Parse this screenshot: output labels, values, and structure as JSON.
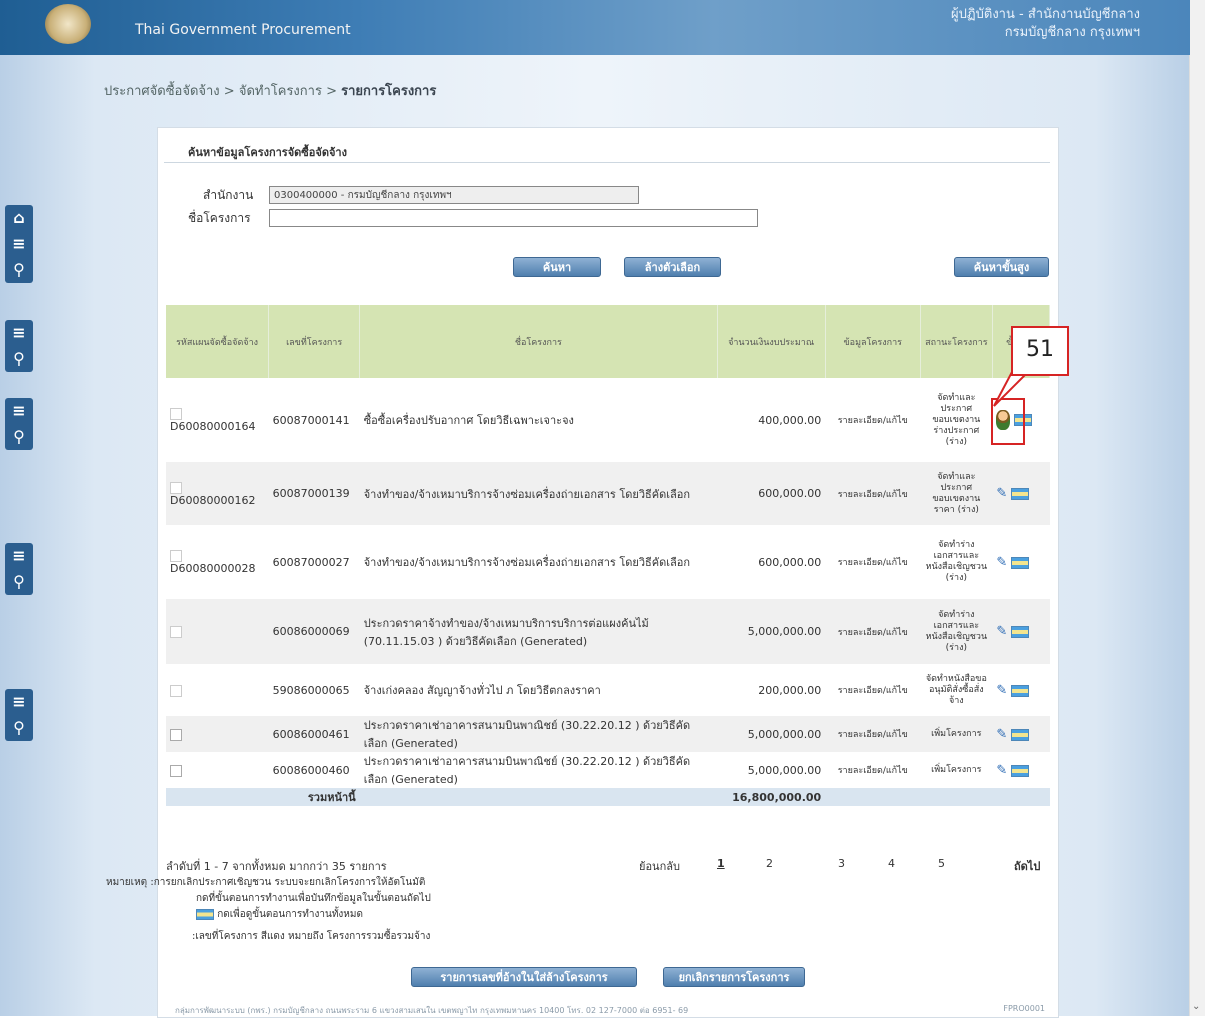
{
  "header": {
    "title": "Thai Government Procurement",
    "right_line1": "ผู้ปฏิบัติงาน - สำนักงานบัญชีกลาง",
    "right_line2": "กรมบัญชีกลาง กรุงเทพฯ"
  },
  "breadcrumb": {
    "part1": "ประกาศจัดซื้อจัดจ้าง",
    "sep": ">",
    "part2": "จัดทำโครงการ",
    "part3": "รายการโครงการ"
  },
  "sidebar": {
    "icons": [
      "home-icon",
      "menu-icon",
      "search-icon"
    ]
  },
  "search": {
    "panel_title": "ค้นหาข้อมูลโครงการจัดซื้อจัดจ้าง",
    "office_label": "สำนักงาน",
    "office_value": "0300400000 - กรมบัญชีกลาง กรุงเทพฯ",
    "project_label": "ชื่อโครงการ",
    "project_value": "",
    "search_button": "ค้นหา",
    "clear_button": "ล้างตัวเลือก",
    "advanced_button": "ค้นหาขั้นสูง"
  },
  "table": {
    "headers": {
      "plan_no": "รหัสแผนจัดซื้อจัดจ้าง",
      "project_no": "เลขที่โครงการ",
      "project_name": "ชื่อโครงการ",
      "budget": "จำนวนเงินงบประมาณ",
      "info": "ข้อมูลโครงการ",
      "status": "สถานะโครงการ",
      "step": "ขั้นตอน"
    },
    "link_text": "รายละเอียด/แก้ไข",
    "rows": [
      {
        "plan_no": "D60080000164",
        "project_no": "60087000141",
        "name": "ซื้อซื้อเครื่องปรับอากาศ โดยวิธีเฉพาะเจาะจง",
        "budget": "400,000.00",
        "status": "จัดทำและประกาศ ขอบเขตงาน ร่างประกาศ (ร่าง)"
      },
      {
        "plan_no": "D60080000162",
        "project_no": "60087000139",
        "name": "จ้างทำของ/จ้างเหมาบริการจ้างซ่อมเครื่องถ่ายเอกสาร โดยวิธีคัดเลือก",
        "budget": "600,000.00",
        "status": "จัดทำและประกาศ ขอบเขตงาน ราคา (ร่าง)"
      },
      {
        "plan_no": "D60080000028",
        "project_no": "60087000027",
        "name": "จ้างทำของ/จ้างเหมาบริการจ้างซ่อมเครื่องถ่ายเอกสาร โดยวิธีคัดเลือก",
        "budget": "600,000.00",
        "status": "จัดทำร่างเอกสารและหนังสือเชิญชวน (ร่าง)"
      },
      {
        "plan_no": "",
        "project_no": "60086000069",
        "name": "ประกวดราคาจ้างทำของ/จ้างเหมาบริการบริการต่อแผงค้นไม้ (70.11.15.03 ) ด้วยวิธีคัดเลือก (Generated)",
        "budget": "5,000,000.00",
        "status": "จัดทำร่างเอกสารและหนังสือเชิญชวน (ร่าง)"
      },
      {
        "plan_no": "",
        "project_no": "59086000065",
        "name": "จ้างเก่งคลอง สัญญาจ้างทั่วไป ภ โดยวิธีตกลงราคา",
        "budget": "200,000.00",
        "status": "จัดทำหนังสือขออนุมัติสั่งซื้อสั่งจ้าง"
      },
      {
        "plan_no": "",
        "project_no": "60086000461",
        "name": "ประกวดราคาเช่าอาคารสนามบินพาณิชย์ (30.22.20.12 ) ด้วยวิธีคัดเลือก (Generated)",
        "budget": "5,000,000.00",
        "status": "เพิ่มโครงการ"
      },
      {
        "plan_no": "",
        "project_no": "60086000460",
        "name": "ประกวดราคาเช่าอาคารสนามบินพาณิชย์ (30.22.20.12 ) ด้วยวิธีคัดเลือก (Generated)",
        "budget": "5,000,000.00",
        "status": "เพิ่มโครงการ"
      }
    ],
    "total_label": "รวมหน้านี้",
    "total_value": "16,800,000.00"
  },
  "pagination": {
    "summary": "ลำดับที่ 1 - 7 จากทั้งหมด มากกว่า 35 รายการ",
    "prev": "ย้อนกลับ",
    "pages": [
      "1",
      "2",
      "3",
      "4",
      "5"
    ],
    "next": "ถัดไป"
  },
  "notes": {
    "line1": "หมายเหตุ :การยกเลิกประกาศเชิญชวน ระบบจะยกเลิกโครงการให้อัตโนมัติ",
    "line2": "กดที่ขั้นตอนการทำงานเพื่อบันทึกข้อมูลในขั้นตอนถัดไป",
    "line3": "กดเพื่อดูขั้นตอนการทำงานทั้งหมด",
    "line4": ":เลขที่โครงการ สีแดง หมายถึง โครงการรวมซื้อรวมจ้าง"
  },
  "bottom_buttons": {
    "left": "รายการเลขที่อ้างในใส่ล้างโครงการ",
    "right": "ยกเลิกรายการโครงการ"
  },
  "footer": {
    "text": "กลุ่มการพัฒนาระบบ (กพร.) กรมบัญชีกลาง ถนนพระราม 6 แขวงสามเสนใน เขตพญาไท กรุงเทพมหานคร 10400 โทร. 02 127-7000 ต่อ 6951- 69",
    "code": "FPRO0001"
  },
  "callout": {
    "label": "51"
  },
  "colors": {
    "header": "#2f6da6",
    "table_header": "#d5e4b3",
    "callout": "#d62424",
    "sidebar": "#2b5e8f"
  }
}
